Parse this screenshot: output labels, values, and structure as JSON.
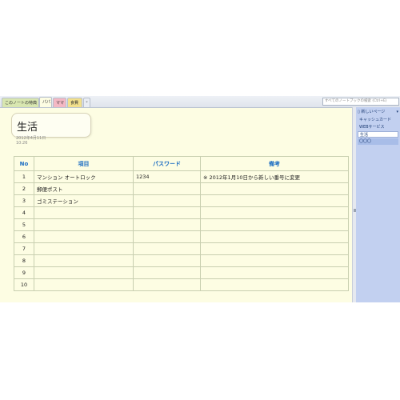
{
  "tabs": {
    "section_tab": "このノートの特典",
    "items": [
      "パパ",
      "ママ",
      "食費"
    ],
    "add_label": "*"
  },
  "search": {
    "placeholder": "すべてのノートブックの検索 (Ctrl+E)"
  },
  "page": {
    "title": "生活",
    "date": "2012年4月11日",
    "time": "10:26"
  },
  "table": {
    "headers": [
      "No",
      "項目",
      "パスワード",
      "備考"
    ],
    "rows": [
      [
        "1",
        "マンション オートロック",
        "1234",
        "※ 2012年1月10日から新しい番号に変更"
      ],
      [
        "2",
        "郵便ポスト",
        "",
        ""
      ],
      [
        "3",
        "ゴミステーション",
        "",
        ""
      ],
      [
        "4",
        "",
        "",
        ""
      ],
      [
        "5",
        "",
        "",
        ""
      ],
      [
        "6",
        "",
        "",
        ""
      ],
      [
        "7",
        "",
        "",
        ""
      ],
      [
        "8",
        "",
        "",
        ""
      ],
      [
        "9",
        "",
        "",
        ""
      ],
      [
        "10",
        "",
        "",
        ""
      ]
    ]
  },
  "sidebar": {
    "new_page_label": "新しいページ",
    "pages": [
      "キャッシュカード",
      "WEBサービス",
      "生活",
      "〇〇〇"
    ]
  },
  "colors": {
    "header_text": "#1f6fc3",
    "page_bg": "#fdfde3",
    "sidebar_bg": "#c2d0f0"
  },
  "icons": [
    "new-page-icon",
    "chevron-down-icon",
    "splitter-handle-icon"
  ]
}
